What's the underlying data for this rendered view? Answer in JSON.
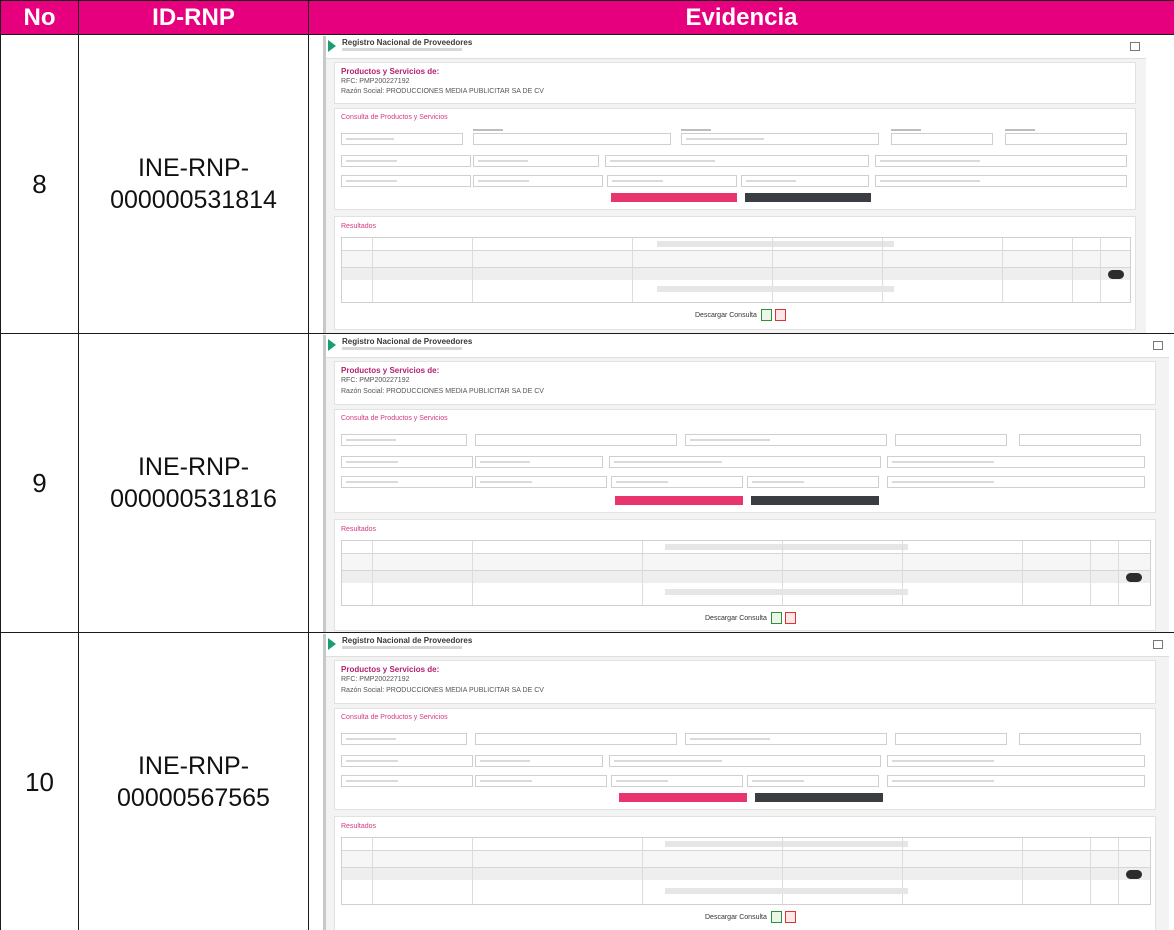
{
  "table": {
    "headers": {
      "no": "No",
      "id": "ID-RNP",
      "evidence": "Evidencia"
    },
    "rows": [
      {
        "no": "8",
        "id_line1": "INE-RNP-",
        "id_line2": "000000531814",
        "evidence": {
          "app_title": "Registro Nacional de Proveedores",
          "heading": "Productos y Servicios de:",
          "rfc": "RFC: PMP200227192",
          "razon": "Razón Social: PRODUCCIONES MEDIA PUBLICITAR SA DE CV",
          "section": "Consulta de Productos y Servicios",
          "results": "Resultados",
          "download": "Descargar Consulta"
        }
      },
      {
        "no": "9",
        "id_line1": "INE-RNP-",
        "id_line2": "000000531816",
        "evidence": {
          "app_title": "Registro Nacional de Proveedores",
          "heading": "Productos y Servicios de:",
          "rfc": "RFC: PMP200227192",
          "razon": "Razón Social: PRODUCCIONES MEDIA PUBLICITAR SA DE CV",
          "section": "Consulta de Productos y Servicios",
          "results": "Resultados",
          "download": "Descargar Consulta"
        }
      },
      {
        "no": "10",
        "id_line1": "INE-RNP-",
        "id_line2": "00000567565",
        "evidence": {
          "app_title": "Registro Nacional de Proveedores",
          "heading": "Productos y Servicios de:",
          "rfc": "RFC: PMP200227192",
          "razon": "Razón Social: PRODUCCIONES MEDIA PUBLICITAR SA DE CV",
          "section": "Consulta de Productos y Servicios",
          "results": "Resultados",
          "download": "Descargar Consulta"
        }
      }
    ]
  },
  "colors": {
    "header_bg": "#e6007e",
    "header_text": "#ffffff",
    "accent_pink": "#e8356e",
    "dark_button": "#3a3e42",
    "nav_arrow": "#1b9e6f"
  },
  "icons": {
    "nav": "triangle-right",
    "window": "restore-window",
    "excel": "excel-file",
    "pdf": "pdf-file"
  }
}
